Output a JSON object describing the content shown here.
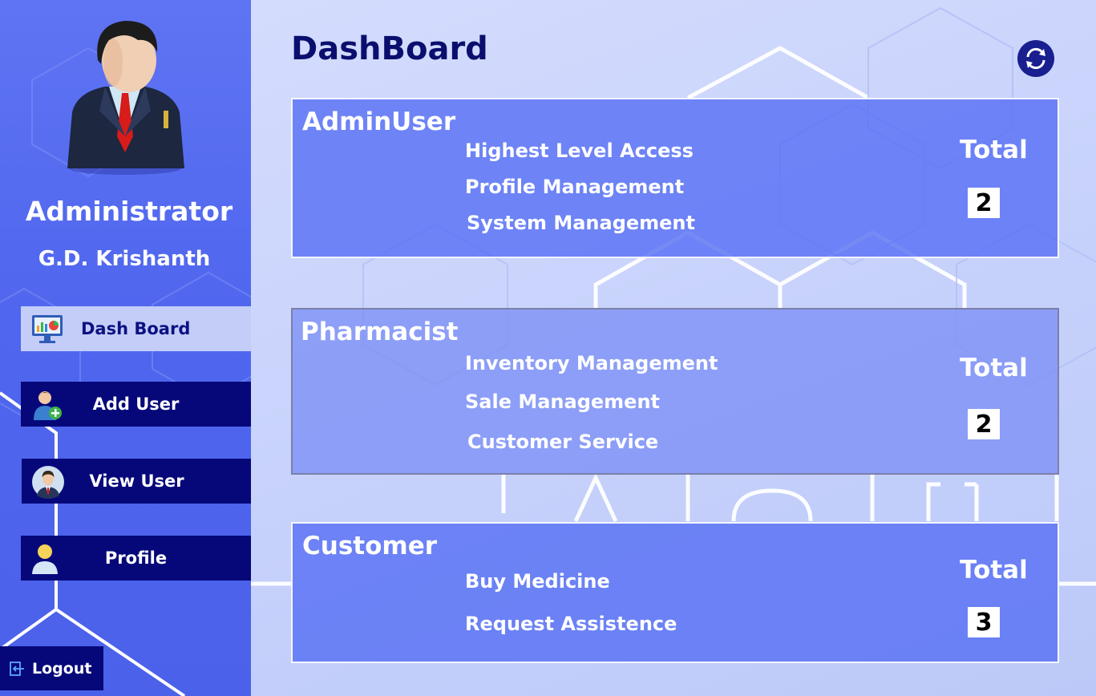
{
  "sidebar": {
    "role": "Administrator",
    "username": "G.D. Krishanth",
    "nav": [
      {
        "label": "Dash Board",
        "icon": "monitor-chart-icon",
        "active": true
      },
      {
        "label": "Add User",
        "icon": "add-user-icon",
        "active": false
      },
      {
        "label": "View User",
        "icon": "user-avatar-icon",
        "active": false
      },
      {
        "label": "Profile",
        "icon": "profile-icon",
        "active": false
      }
    ],
    "logout_label": "Logout"
  },
  "main": {
    "title": "DashBoard",
    "refresh_icon": "refresh-icon",
    "cards": [
      {
        "title": "AdminUser",
        "features": [
          "Highest Level Access",
          "Profile Management",
          "System Management"
        ],
        "total_label": "Total",
        "total": "2"
      },
      {
        "title": "Pharmacist",
        "features": [
          "Inventory Management",
          "Sale Management",
          "Customer Service"
        ],
        "total_label": "Total",
        "total": "2"
      },
      {
        "title": "Customer",
        "features": [
          "Buy Medicine",
          "Request Assistence"
        ],
        "total_label": "Total",
        "total": "3"
      }
    ]
  },
  "colors": {
    "sidebar_bg": "#5068ef",
    "nav_bg": "#06087a",
    "nav_active_bg": "#c4cdf7",
    "title_color": "#0a0f6e",
    "card_bg": "#5870f4"
  }
}
